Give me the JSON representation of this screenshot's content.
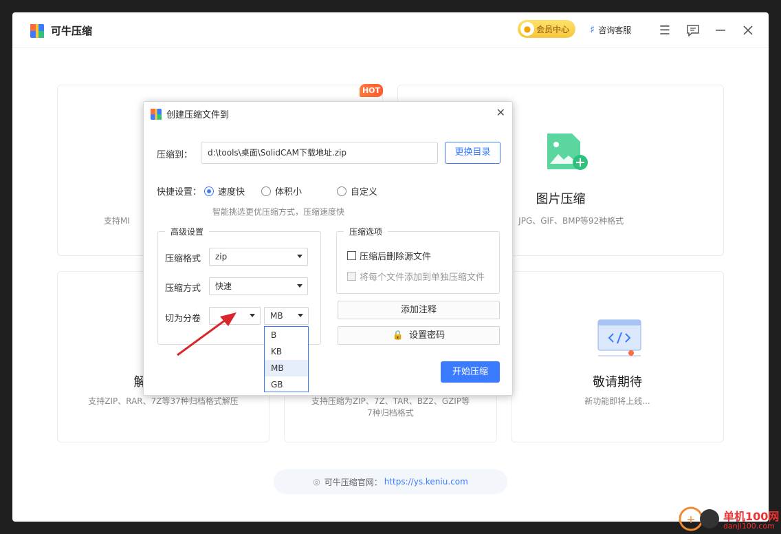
{
  "app": {
    "title": "可牛压缩",
    "vip_label": "会员中心",
    "support_label": "咨询客服"
  },
  "cards": {
    "hot_badge": "HOT",
    "image": {
      "title": "图片压缩",
      "desc": "NG、JPG、GIF、BMP等92种格式"
    },
    "left_top_desc": "支持MI",
    "extract": {
      "title_partial": "解",
      "desc": "支持ZIP、RAR、7Z等37种归档格式解压"
    },
    "compress": {
      "desc_line1": "支持压缩为ZIP、7Z、TAR、BZ2、GZIP等",
      "desc_line2": "7种归档格式"
    },
    "coming": {
      "title": "敬请期待",
      "desc": "新功能即将上线..."
    }
  },
  "footer": {
    "label": "可牛压缩官网：",
    "url": "https://ys.keniu.com"
  },
  "dialog": {
    "title": "创建压缩文件到",
    "dest_label": "压缩到：",
    "dest_path": "d:\\tools\\桌面\\SolidCAM下载地址.zip",
    "change_dir": "更换目录",
    "quick_label": "快捷设置：",
    "quick_options": [
      "速度快",
      "体积小",
      "自定义"
    ],
    "quick_selected": "速度快",
    "quick_hint": "智能挑选更优压缩方式，压缩速度快",
    "advanced": {
      "title": "高级设置",
      "format_label": "压缩格式",
      "format_value": "zip",
      "method_label": "压缩方式",
      "method_value": "快速",
      "split_label": "切为分卷",
      "split_value": "",
      "unit_value": "MB",
      "unit_options": [
        "B",
        "KB",
        "MB",
        "GB"
      ],
      "unit_highlighted": "MB"
    },
    "options": {
      "title": "压缩选项",
      "delete_source": "压缩后删除源文件",
      "each_file": "将每个文件添加到单独压缩文件",
      "add_comment": "添加注释",
      "set_password": "设置密码"
    },
    "start": "开始压缩"
  },
  "watermark": {
    "text": "单机100网",
    "url": "danji100.com"
  }
}
